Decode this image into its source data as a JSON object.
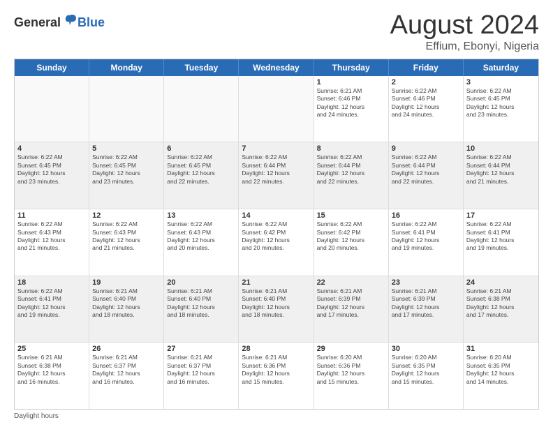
{
  "logo": {
    "general": "General",
    "blue": "Blue"
  },
  "title": "August 2024",
  "subtitle": "Effium, Ebonyi, Nigeria",
  "headers": [
    "Sunday",
    "Monday",
    "Tuesday",
    "Wednesday",
    "Thursday",
    "Friday",
    "Saturday"
  ],
  "weeks": [
    [
      {
        "day": "",
        "info": "",
        "empty": true
      },
      {
        "day": "",
        "info": "",
        "empty": true
      },
      {
        "day": "",
        "info": "",
        "empty": true
      },
      {
        "day": "",
        "info": "",
        "empty": true
      },
      {
        "day": "1",
        "info": "Sunrise: 6:21 AM\nSunset: 6:46 PM\nDaylight: 12 hours\nand 24 minutes."
      },
      {
        "day": "2",
        "info": "Sunrise: 6:22 AM\nSunset: 6:46 PM\nDaylight: 12 hours\nand 24 minutes."
      },
      {
        "day": "3",
        "info": "Sunrise: 6:22 AM\nSunset: 6:45 PM\nDaylight: 12 hours\nand 23 minutes."
      }
    ],
    [
      {
        "day": "4",
        "info": "Sunrise: 6:22 AM\nSunset: 6:45 PM\nDaylight: 12 hours\nand 23 minutes."
      },
      {
        "day": "5",
        "info": "Sunrise: 6:22 AM\nSunset: 6:45 PM\nDaylight: 12 hours\nand 23 minutes."
      },
      {
        "day": "6",
        "info": "Sunrise: 6:22 AM\nSunset: 6:45 PM\nDaylight: 12 hours\nand 22 minutes."
      },
      {
        "day": "7",
        "info": "Sunrise: 6:22 AM\nSunset: 6:44 PM\nDaylight: 12 hours\nand 22 minutes."
      },
      {
        "day": "8",
        "info": "Sunrise: 6:22 AM\nSunset: 6:44 PM\nDaylight: 12 hours\nand 22 minutes."
      },
      {
        "day": "9",
        "info": "Sunrise: 6:22 AM\nSunset: 6:44 PM\nDaylight: 12 hours\nand 22 minutes."
      },
      {
        "day": "10",
        "info": "Sunrise: 6:22 AM\nSunset: 6:44 PM\nDaylight: 12 hours\nand 21 minutes."
      }
    ],
    [
      {
        "day": "11",
        "info": "Sunrise: 6:22 AM\nSunset: 6:43 PM\nDaylight: 12 hours\nand 21 minutes."
      },
      {
        "day": "12",
        "info": "Sunrise: 6:22 AM\nSunset: 6:43 PM\nDaylight: 12 hours\nand 21 minutes."
      },
      {
        "day": "13",
        "info": "Sunrise: 6:22 AM\nSunset: 6:43 PM\nDaylight: 12 hours\nand 20 minutes."
      },
      {
        "day": "14",
        "info": "Sunrise: 6:22 AM\nSunset: 6:42 PM\nDaylight: 12 hours\nand 20 minutes."
      },
      {
        "day": "15",
        "info": "Sunrise: 6:22 AM\nSunset: 6:42 PM\nDaylight: 12 hours\nand 20 minutes."
      },
      {
        "day": "16",
        "info": "Sunrise: 6:22 AM\nSunset: 6:41 PM\nDaylight: 12 hours\nand 19 minutes."
      },
      {
        "day": "17",
        "info": "Sunrise: 6:22 AM\nSunset: 6:41 PM\nDaylight: 12 hours\nand 19 minutes."
      }
    ],
    [
      {
        "day": "18",
        "info": "Sunrise: 6:22 AM\nSunset: 6:41 PM\nDaylight: 12 hours\nand 19 minutes."
      },
      {
        "day": "19",
        "info": "Sunrise: 6:21 AM\nSunset: 6:40 PM\nDaylight: 12 hours\nand 18 minutes."
      },
      {
        "day": "20",
        "info": "Sunrise: 6:21 AM\nSunset: 6:40 PM\nDaylight: 12 hours\nand 18 minutes."
      },
      {
        "day": "21",
        "info": "Sunrise: 6:21 AM\nSunset: 6:40 PM\nDaylight: 12 hours\nand 18 minutes."
      },
      {
        "day": "22",
        "info": "Sunrise: 6:21 AM\nSunset: 6:39 PM\nDaylight: 12 hours\nand 17 minutes."
      },
      {
        "day": "23",
        "info": "Sunrise: 6:21 AM\nSunset: 6:39 PM\nDaylight: 12 hours\nand 17 minutes."
      },
      {
        "day": "24",
        "info": "Sunrise: 6:21 AM\nSunset: 6:38 PM\nDaylight: 12 hours\nand 17 minutes."
      }
    ],
    [
      {
        "day": "25",
        "info": "Sunrise: 6:21 AM\nSunset: 6:38 PM\nDaylight: 12 hours\nand 16 minutes."
      },
      {
        "day": "26",
        "info": "Sunrise: 6:21 AM\nSunset: 6:37 PM\nDaylight: 12 hours\nand 16 minutes."
      },
      {
        "day": "27",
        "info": "Sunrise: 6:21 AM\nSunset: 6:37 PM\nDaylight: 12 hours\nand 16 minutes."
      },
      {
        "day": "28",
        "info": "Sunrise: 6:21 AM\nSunset: 6:36 PM\nDaylight: 12 hours\nand 15 minutes."
      },
      {
        "day": "29",
        "info": "Sunrise: 6:20 AM\nSunset: 6:36 PM\nDaylight: 12 hours\nand 15 minutes."
      },
      {
        "day": "30",
        "info": "Sunrise: 6:20 AM\nSunset: 6:35 PM\nDaylight: 12 hours\nand 15 minutes."
      },
      {
        "day": "31",
        "info": "Sunrise: 6:20 AM\nSunset: 6:35 PM\nDaylight: 12 hours\nand 14 minutes."
      }
    ]
  ],
  "footer": "Daylight hours"
}
